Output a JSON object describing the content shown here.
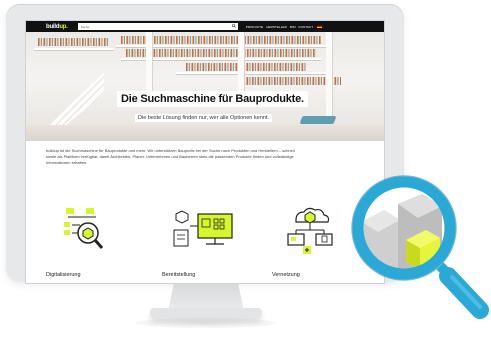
{
  "website": {
    "logo": "build",
    "logo_suffix": "up.",
    "search": {
      "value": "Suche"
    },
    "nav_links": [
      "PRODUKTE",
      "HERSTELLER",
      "BIM",
      "KONTAKT"
    ],
    "hero": {
      "title": "Die Suchmaschine für Bauprodukte.",
      "subtitle": "Die beste Lösung finden nur, wer alle Optionen kennt."
    },
    "intro_lines": [
      "buildup ist die Suchmaschine für Bauprodukte und mehr. Wir unterstützen Bauprofis bei der Suche nach Produkten und Herstellern – schnell",
      "sowie als Plattform verfügbar, damit Architekten, Planer, Unternehmen und Bauherren stets die passenden Produkte finden und vollständige",
      "Informationen erhalten."
    ],
    "features": [
      {
        "label": "Digitalisierung",
        "icon": "digitalization-icon"
      },
      {
        "label": "Bereitstellung",
        "icon": "provisioning-icon"
      },
      {
        "label": "Vernetzung",
        "icon": "networking-icon"
      }
    ]
  },
  "colors": {
    "accent": "#d7f72d",
    "nav_bg": "#111111",
    "magnifier": "#2aa9d6",
    "monitor": "#e7e8ea"
  }
}
